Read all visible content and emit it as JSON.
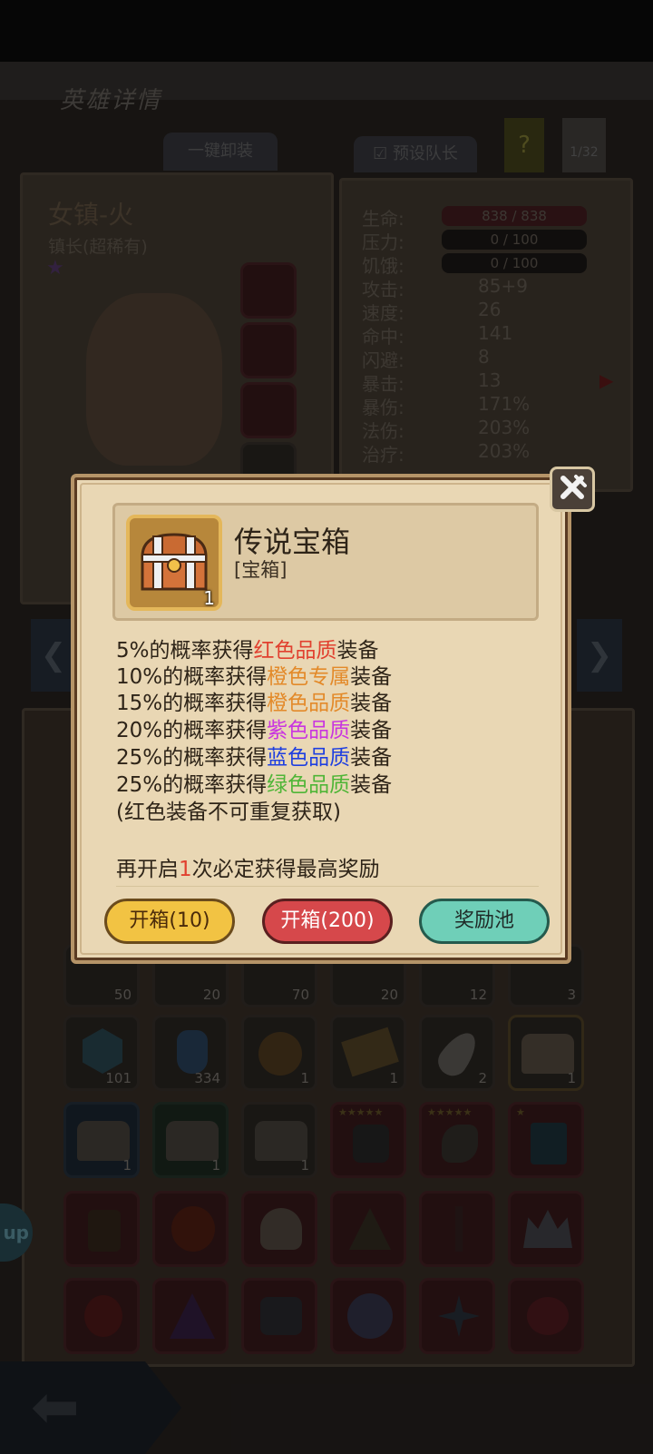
{
  "screen": {
    "title": "英雄详情",
    "unequip_all": "一键卸装",
    "preset_captain": "预设队长",
    "help": "?",
    "page_counter": "1/32"
  },
  "hero": {
    "name": "女镇-火",
    "role": "镇长(超稀有)"
  },
  "stats": [
    {
      "label": "生命:",
      "value": "838 / 838",
      "bar": true
    },
    {
      "label": "压力:",
      "value": "0 / 100",
      "bar": true
    },
    {
      "label": "饥饿:",
      "value": "0 / 100",
      "bar": true
    },
    {
      "label": "攻击:",
      "value": "85+9"
    },
    {
      "label": "速度:",
      "value": "26"
    },
    {
      "label": "命中:",
      "value": "141"
    },
    {
      "label": "闪避:",
      "value": "8"
    },
    {
      "label": "暴击:",
      "value": "13"
    },
    {
      "label": "暴伤:",
      "value": "171%"
    },
    {
      "label": "法伤:",
      "value": "203%"
    },
    {
      "label": "治疗:",
      "value": "203%"
    }
  ],
  "inventory": {
    "row1_counts": [
      "50",
      "20",
      "70",
      "20",
      "12",
      "3"
    ],
    "row2_counts": [
      "101",
      "334",
      "1",
      "1",
      "2",
      "1"
    ],
    "row3_counts": [
      "1",
      "1",
      "1",
      "",
      "",
      ""
    ]
  },
  "dialog": {
    "item_name": "传说宝箱",
    "item_type": "[宝箱]",
    "item_count": "1",
    "lines": [
      {
        "pre": "5%的概率获得",
        "hl": "红色品质",
        "post": "装备",
        "color": "#e1402f"
      },
      {
        "pre": "10%的概率获得",
        "hl": "橙色专属",
        "post": "装备",
        "color": "#e38a2a"
      },
      {
        "pre": "15%的概率获得",
        "hl": "橙色品质",
        "post": "装备",
        "color": "#e38a2a"
      },
      {
        "pre": "20%的概率获得",
        "hl": "紫色品质",
        "post": "装备",
        "color": "#c935e0"
      },
      {
        "pre": "25%的概率获得",
        "hl": "蓝色品质",
        "post": "装备",
        "color": "#1f3fe0"
      },
      {
        "pre": "25%的概率获得",
        "hl": "绿色品质",
        "post": "装备",
        "color": "#4fb537"
      }
    ],
    "note": "(红色装备不可重复获取)",
    "pity_pre": "再开启",
    "pity_count": "1",
    "pity_post": "次必定获得最高奖励",
    "buttons": {
      "open10": "开箱(10)",
      "open200": "开箱(200)",
      "reward_pool": "奖励池"
    }
  },
  "side_tab": "up"
}
